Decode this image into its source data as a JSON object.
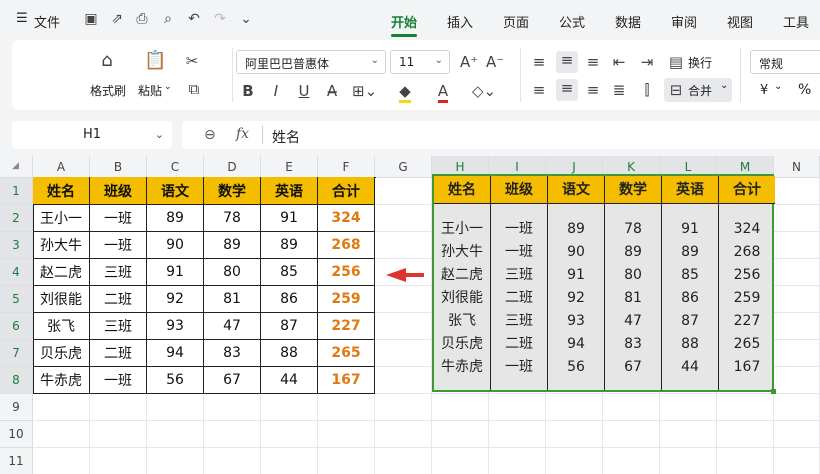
{
  "menubar": {
    "file_label": "文件",
    "tabs": [
      "开始",
      "插入",
      "页面",
      "公式",
      "数据",
      "审阅",
      "视图",
      "工具"
    ]
  },
  "ribbon": {
    "format_painter": "格式刷",
    "paste": "粘贴",
    "font_name": "阿里巴巴普惠体",
    "font_size": "11",
    "wrap": "换行",
    "merge": "合并",
    "number_format": "常规",
    "currency_symbol": "¥",
    "percent_symbol": "%",
    "bold": "B",
    "italic": "I",
    "underline": "U"
  },
  "formula_bar": {
    "name_box": "H1",
    "fx": "fx",
    "content": "姓名"
  },
  "columns": [
    "A",
    "B",
    "C",
    "D",
    "E",
    "F",
    "G",
    "H",
    "I",
    "J",
    "K",
    "L",
    "M",
    "N"
  ],
  "rows": [
    "1",
    "2",
    "3",
    "4",
    "5",
    "6",
    "7",
    "8",
    "9",
    "10",
    "11"
  ],
  "table_left": {
    "headers": [
      "姓名",
      "班级",
      "语文",
      "数学",
      "英语",
      "合计"
    ],
    "rows": [
      [
        "王小一",
        "一班",
        "89",
        "78",
        "91",
        "324"
      ],
      [
        "孙大牛",
        "一班",
        "90",
        "89",
        "89",
        "268"
      ],
      [
        "赵二虎",
        "三班",
        "91",
        "80",
        "85",
        "256"
      ],
      [
        "刘很能",
        "二班",
        "92",
        "81",
        "86",
        "259"
      ],
      [
        "张飞",
        "三班",
        "93",
        "47",
        "87",
        "227"
      ],
      [
        "贝乐虎",
        "二班",
        "94",
        "83",
        "88",
        "265"
      ],
      [
        "牛赤虎",
        "一班",
        "56",
        "67",
        "44",
        "167"
      ]
    ]
  },
  "table_right": {
    "headers": [
      "姓名",
      "班级",
      "语文",
      "数学",
      "英语",
      "合计"
    ],
    "columns": [
      [
        "王小一",
        "孙大牛",
        "赵二虎",
        "刘很能",
        "张飞",
        "贝乐虎",
        "牛赤虎"
      ],
      [
        "一班",
        "一班",
        "三班",
        "二班",
        "三班",
        "二班",
        "一班"
      ],
      [
        "89",
        "90",
        "91",
        "92",
        "93",
        "94",
        "56"
      ],
      [
        "78",
        "89",
        "80",
        "81",
        "47",
        "83",
        "67"
      ],
      [
        "91",
        "89",
        "85",
        "86",
        "87",
        "88",
        "44"
      ],
      [
        "324",
        "268",
        "256",
        "259",
        "227",
        "265",
        "167"
      ]
    ]
  },
  "colors": {
    "header_fill": "#f5bd00",
    "total_text": "#e07a10",
    "accent_green": "#1a7f37",
    "arrow": "#e0332e"
  }
}
